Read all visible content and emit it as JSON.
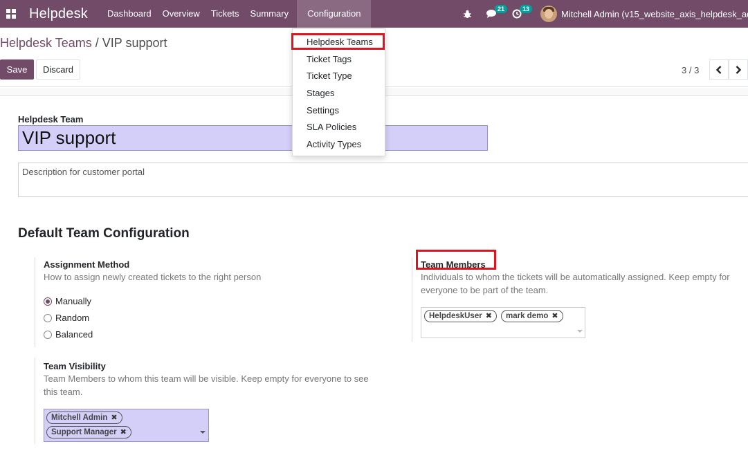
{
  "navbar": {
    "brand": "Helpdesk",
    "menu": [
      "Dashboard",
      "Overview",
      "Tickets",
      "Summary",
      "Configuration"
    ],
    "messages_count": "21",
    "activities_count": "13",
    "user_name": "Mitchell Admin (v15_website_axis_helpdesk_ad"
  },
  "breadcrumb": {
    "parent": "Helpdesk Teams",
    "separator": "/",
    "current": "VIP support"
  },
  "buttons": {
    "save": "Save",
    "discard": "Discard"
  },
  "pager": {
    "value": "3 / 3"
  },
  "config_menu": [
    "Helpdesk Teams",
    "Ticket Tags",
    "Ticket Type",
    "Stages",
    "Settings",
    "SLA Policies",
    "Activity Types"
  ],
  "form": {
    "team_label": "Helpdesk Team",
    "team_name": "VIP support",
    "description_placeholder": "Description for customer portal",
    "section_title": "Default Team Configuration",
    "assignment": {
      "label": "Assignment Method",
      "help": "How to assign newly created tickets to the right person",
      "options": [
        "Manually",
        "Random",
        "Balanced"
      ],
      "selected": "Manually"
    },
    "members": {
      "label": "Team Members",
      "help_line1": "Individuals to whom the tickets will be automatically assigned. Keep empty for",
      "help_line2": "everyone to be part of the team.",
      "tags": [
        "HelpdeskUser",
        "mark demo"
      ]
    },
    "visibility": {
      "label": "Team Visibility",
      "help_line1": "Team Members to whom this team will be visible. Keep empty for everyone to see",
      "help_line2": "this team.",
      "tags": [
        "Mitchell Admin",
        "Support Manager"
      ]
    }
  },
  "colors": {
    "brand": "#714b67",
    "highlight": "#e0141e",
    "input_fill": "#d4cff9",
    "badge": "#00a09d"
  },
  "icons": [
    "apps-grid-icon",
    "bug-icon",
    "chat-icon",
    "clock-icon",
    "chevron-left-icon",
    "chevron-right-icon",
    "remove-tag-icon",
    "caret-down-icon"
  ]
}
